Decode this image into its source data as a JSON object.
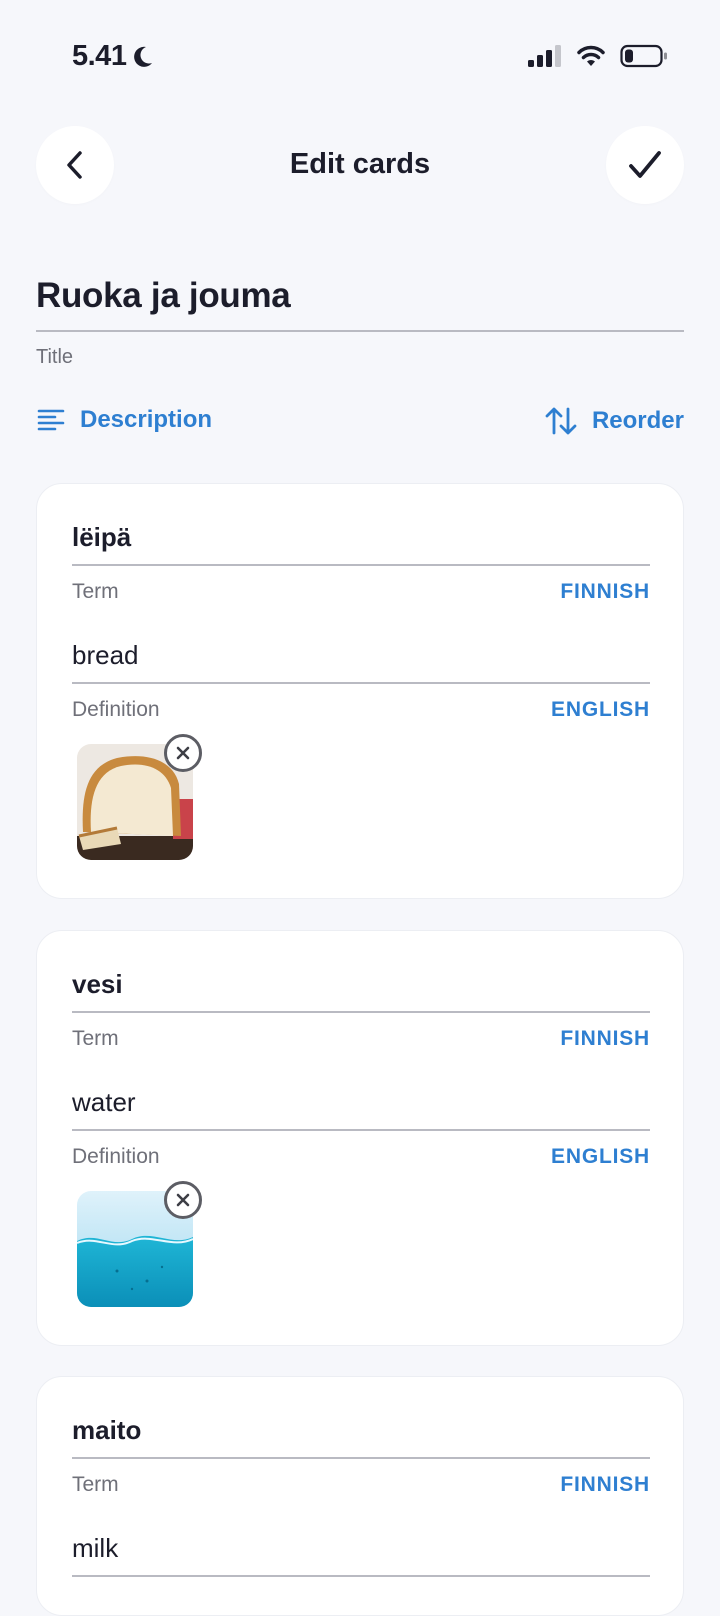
{
  "status_bar": {
    "time": "5.41"
  },
  "header": {
    "title": "Edit cards"
  },
  "set": {
    "title": "Ruoka ja jouma",
    "title_label": "Title"
  },
  "actions": {
    "description_label": "Description",
    "reorder_label": "Reorder"
  },
  "cards": [
    {
      "term": "lëipä",
      "term_label": "Term",
      "term_lang": "FINNISH",
      "definition": "bread",
      "definition_label": "Definition",
      "definition_lang": "ENGLISH",
      "image": "bread-loaf-image"
    },
    {
      "term": "vesi",
      "term_label": "Term",
      "term_lang": "FINNISH",
      "definition": "water",
      "definition_label": "Definition",
      "definition_lang": "ENGLISH",
      "image": "water-surface-image"
    },
    {
      "term": "maito",
      "term_label": "Term",
      "term_lang": "FINNISH",
      "definition": "milk"
    }
  ],
  "colors": {
    "accent": "#2e7fd1",
    "background": "#f6f7fb",
    "card": "#ffffff",
    "text": "#1c1d2b"
  }
}
